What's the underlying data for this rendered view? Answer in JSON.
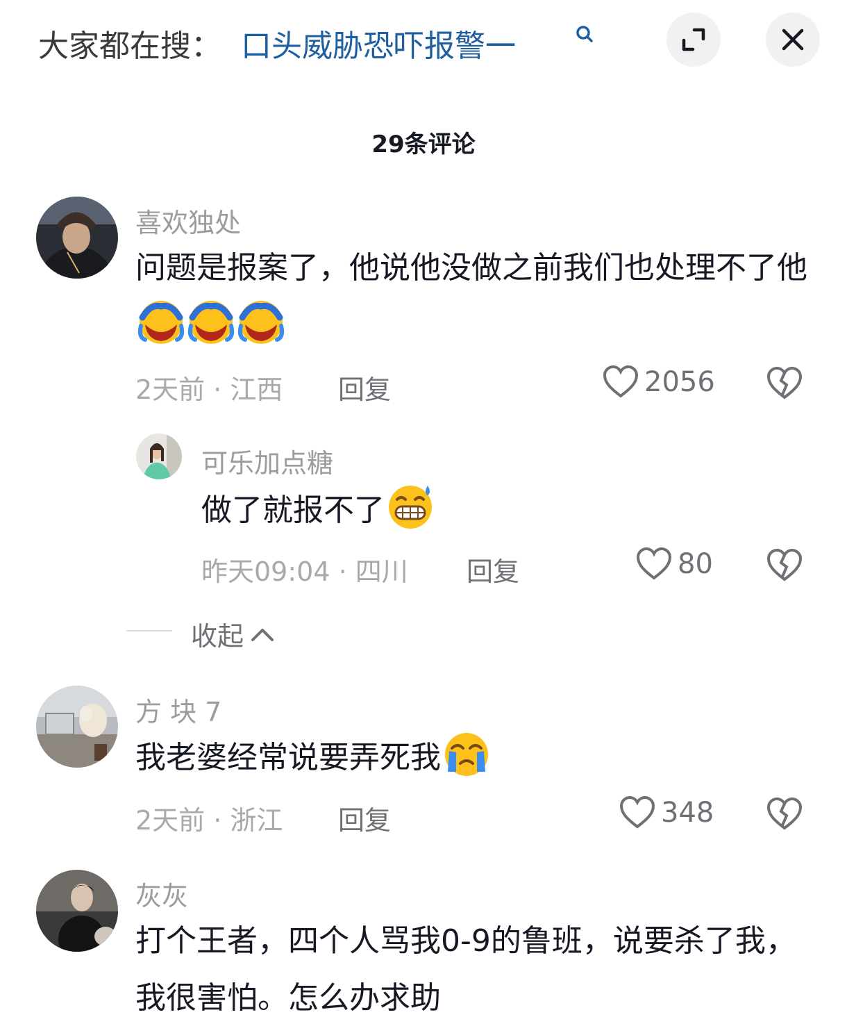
{
  "header": {
    "search_prefix": "大家都在搜：",
    "search_query": "口头威胁恐吓报警一",
    "comment_count": "29条评论"
  },
  "comments": [
    {
      "username": "喜欢独处",
      "content": "问题是报案了，他说他没做之前我们也处理不了他",
      "time_location": "2天前 · 江西",
      "reply_label": "回复",
      "likes": "2056"
    },
    {
      "username": "方 块 7",
      "content": "我老婆经常说要弄死我",
      "time_location": "2天前 · 浙江",
      "reply_label": "回复",
      "likes": "348"
    },
    {
      "username": "灰灰",
      "content": "打个王者，四个人骂我0-9的鲁班，说要杀了我，我很害怕。怎么办求助"
    }
  ],
  "reply": {
    "username": "可乐加点糖",
    "content": "做了就报不了",
    "time_location": "昨天09:04 · 四川",
    "reply_label": "回复",
    "likes": "80"
  },
  "collapse_label": "收起",
  "colors": {
    "link": "#1f5fa0",
    "meta": "#a8a8ad",
    "text": "#161823"
  }
}
